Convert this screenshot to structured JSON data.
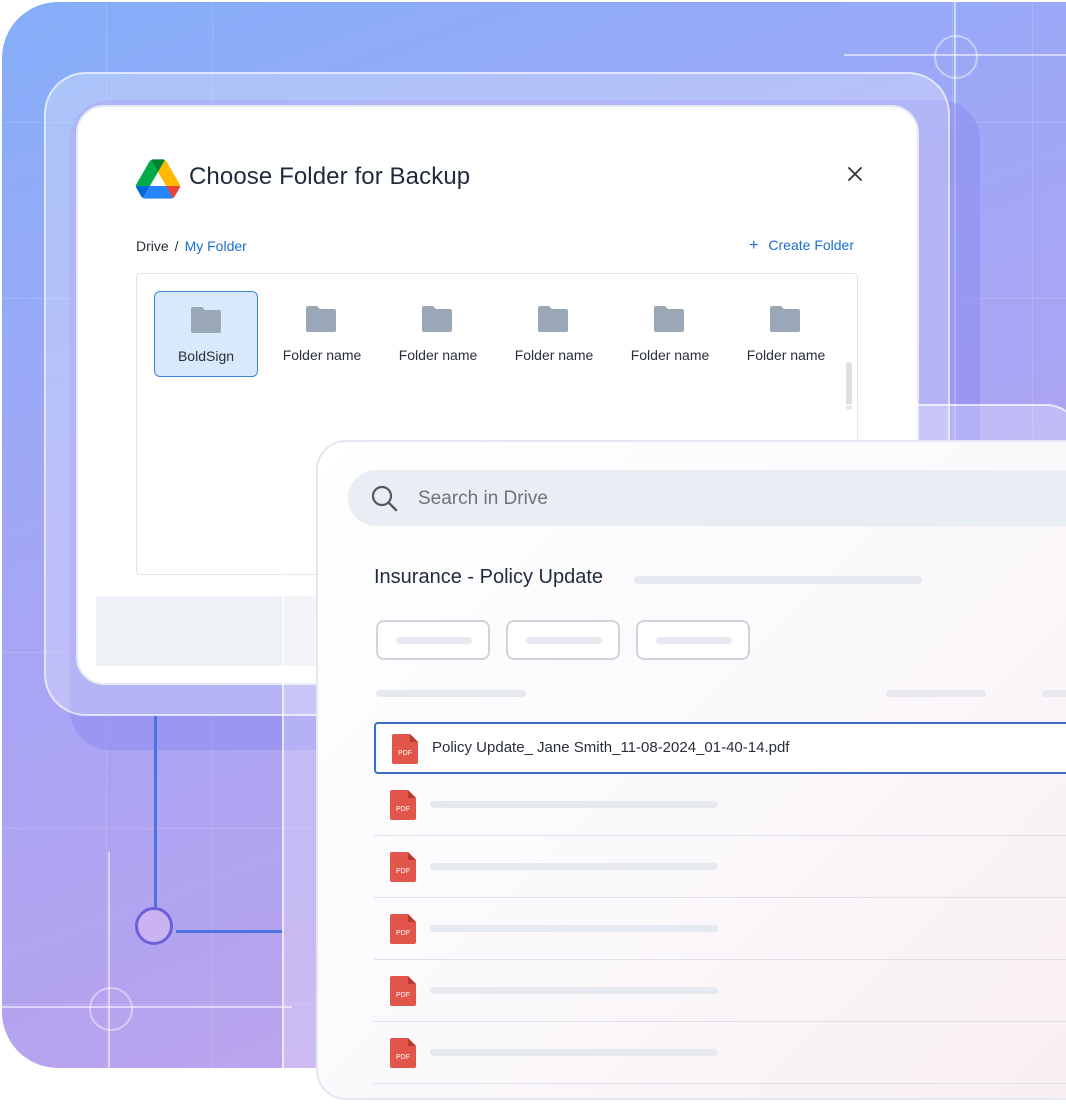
{
  "backup_dialog": {
    "title": "Choose Folder for Backup",
    "close_label": "×",
    "breadcrumb": {
      "root": "Drive",
      "separator": "/",
      "current": "My Folder"
    },
    "create_folder": {
      "icon": "plus-icon",
      "label": "Create Folder"
    },
    "folders": [
      {
        "name": "BoldSign",
        "selected": true
      },
      {
        "name": "Folder name",
        "selected": false
      },
      {
        "name": "Folder name",
        "selected": false
      },
      {
        "name": "Folder name",
        "selected": false
      },
      {
        "name": "Folder name",
        "selected": false
      },
      {
        "name": "Folder name",
        "selected": false
      }
    ]
  },
  "drive_panel": {
    "search": {
      "icon": "search-icon",
      "placeholder": "Search in Drive"
    },
    "document_title": "Insurance - Policy Update",
    "files": [
      {
        "name": "Policy Update_ Jane Smith_11-08-2024_01-40-14.pdf",
        "icon_label": "PDF",
        "selected": true
      },
      {
        "name": "",
        "icon_label": "PDF",
        "selected": false
      },
      {
        "name": "",
        "icon_label": "PDF",
        "selected": false
      },
      {
        "name": "",
        "icon_label": "PDF",
        "selected": false
      },
      {
        "name": "",
        "icon_label": "PDF",
        "selected": false
      },
      {
        "name": "",
        "icon_label": "PDF",
        "selected": false
      }
    ]
  },
  "colors": {
    "accent_blue": "#1a6fd0",
    "selected_folder_bg": "#d8e9fb",
    "pdf_red": "#e2554b",
    "connector_blue": "#4a72e0"
  }
}
